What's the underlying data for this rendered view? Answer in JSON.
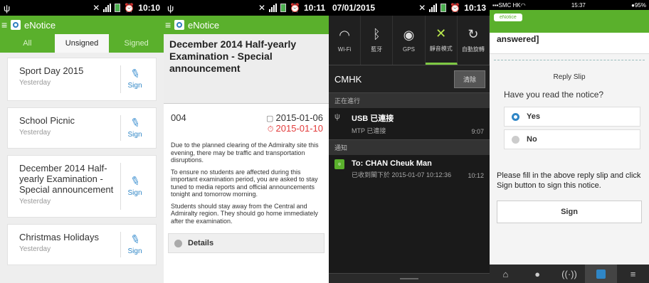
{
  "panel1": {
    "status_time": "10:10",
    "app_title": "eNotice",
    "tabs": [
      {
        "label": "All"
      },
      {
        "label": "Unsigned"
      },
      {
        "label": "Signed"
      }
    ],
    "items": [
      {
        "title": "Sport Day 2015",
        "date": "Yesterday",
        "action": "Sign"
      },
      {
        "title": "School Picnic",
        "date": "Yesterday",
        "action": "Sign"
      },
      {
        "title": "December 2014 Half-yearly Examination - Special announcement",
        "date": "Yesterday",
        "action": "Sign"
      },
      {
        "title": "Christmas Holidays",
        "date": "Yesterday",
        "action": "Sign"
      }
    ]
  },
  "panel2": {
    "status_time": "10:11",
    "app_title": "eNotice",
    "title": "December 2014 Half-yearly Examination - Special announcement",
    "number": "004",
    "issue_date": "2015-01-06",
    "due_date": "2015-01-10",
    "paragraphs": [
      "Due to the planned clearing of the Admiralty site this evening, there may be traffic and transportation disruptions.",
      "To ensure no students are affected during this important examination period, you are asked to stay tuned to media reports and official announcements tonight and tomorrow morning.",
      "Students should stay away from the Central and Admiralty region. They should go home immediately after the examination."
    ],
    "details_label": "Details"
  },
  "panel3": {
    "status_date": "07/01/2015",
    "status_time": "10:13",
    "quick_settings": [
      {
        "label": "Wi-Fi",
        "icon": "wifi-icon"
      },
      {
        "label": "藍牙",
        "icon": "bluetooth-icon"
      },
      {
        "label": "GPS",
        "icon": "gps-icon"
      },
      {
        "label": "靜音模式",
        "icon": "mute-icon"
      },
      {
        "label": "自動旋轉",
        "icon": "rotate-icon"
      }
    ],
    "carrier": "CMHK",
    "clear_label": "清除",
    "ongoing_header": "正在進行",
    "usb_title": "USB 已連接",
    "usb_sub": "MTP 已連接",
    "usb_time": "9:07",
    "notify_header": "通知",
    "notif_title": "To: CHAN Cheuk Man",
    "notif_sub": "已收到閣下於 2015-01-07 10:12:36",
    "notif_time": "10:12"
  },
  "panel4": {
    "carrier": "SMC HK",
    "status_time": "15:37",
    "battery": "95%",
    "back_label": "eNotice",
    "answered_text": "answered]",
    "reply_slip_label": "Reply Slip",
    "question": "Have you read the notice?",
    "options": [
      {
        "label": "Yes",
        "selected": true
      },
      {
        "label": "No",
        "selected": false
      }
    ],
    "instruction": "Please fill in the above reply slip and click Sign button to sign this notice.",
    "sign_label": "Sign"
  },
  "colors": {
    "brand_green": "#5ab02c",
    "link_blue": "#2f86c6",
    "due_red": "#e23b3b"
  }
}
